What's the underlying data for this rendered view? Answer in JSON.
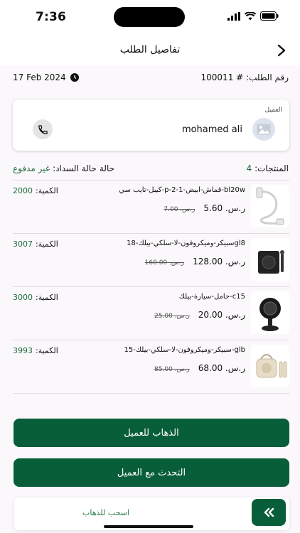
{
  "status_bar": {
    "time": "7:36"
  },
  "nav": {
    "title": "تفاصيل الطلب",
    "back_icon": "chevron-right-icon"
  },
  "order": {
    "number_label": "رقم الطلب: #",
    "number": "100011",
    "date": "17 Feb 2024"
  },
  "customer": {
    "card_label": "العميل",
    "name": "mohamed ali"
  },
  "summary": {
    "products_label": "المنتجات:",
    "products_count": "4",
    "payment_label": "حالة السداد:",
    "payment_status": "غير مدفوع",
    "status_label": "حالة"
  },
  "items": [
    {
      "name": "كيبل-تايب سي-p-2-1-قماش-ابيض-bl20w",
      "price": "5.60",
      "old_price": "7.00",
      "currency": "ر.س.",
      "qty_label": "الكمية:",
      "qty": "2000"
    },
    {
      "name": "سبيكر-وميكروفون-لا-سلكي-بيلك-18gl8",
      "price": "128.00",
      "old_price": "160.00",
      "currency": "ر.س.",
      "qty_label": "الكمية:",
      "qty": "3007"
    },
    {
      "name": "حامل-سيارة-بيلك-c15",
      "price": "20.00",
      "old_price": "25.00",
      "currency": "ر.س.",
      "qty_label": "الكمية:",
      "qty": "3000"
    },
    {
      "name": "سبيكر-وميكروفون-لا-سلكي-بيلك-15-glb",
      "price": "68.00",
      "old_price": "85.00",
      "currency": "ر.س.",
      "qty_label": "الكمية:",
      "qty": "3993"
    }
  ],
  "actions": {
    "go_to_customer": "الذهاب للعميل",
    "talk_to_customer": "التحدث مع العميل",
    "slide_label": "اسحب للذهاب",
    "slide_icon": "double-chevron-left-icon"
  },
  "colors": {
    "accent": "#095e3a",
    "accent_text": "#1f6b40"
  }
}
